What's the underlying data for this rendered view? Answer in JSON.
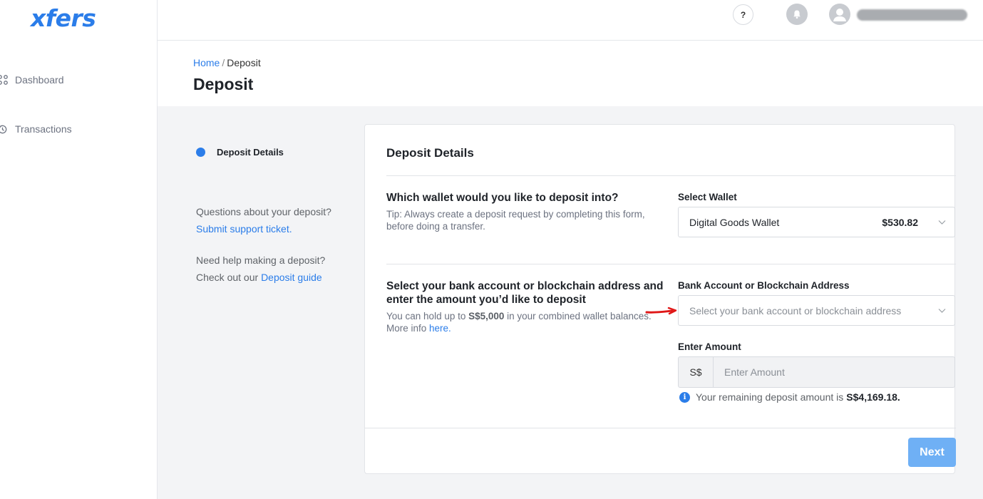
{
  "brand": {
    "logo": "xfers",
    "accent": "#2b7de9"
  },
  "sidebar": {
    "items": [
      {
        "label": "Dashboard",
        "icon": "grid-icon"
      },
      {
        "label": "Transactions",
        "icon": "history-icon"
      }
    ]
  },
  "header": {
    "help_label": "?"
  },
  "breadcrumb": {
    "home": "Home",
    "separator": "/",
    "current": "Deposit"
  },
  "page": {
    "title": "Deposit"
  },
  "steps": {
    "current": "Deposit Details"
  },
  "help": {
    "line1": "Questions about your deposit?",
    "link1": "Submit support ticket.",
    "line2": "Need help making a deposit?",
    "line3_prefix": "Check out our ",
    "link2": "Deposit guide"
  },
  "card": {
    "title": "Deposit Details",
    "wallet_question": "Which wallet would you like to deposit into?",
    "wallet_tip": "Tip: Always create a deposit request by completing this form, before doing a transfer.",
    "wallet_label": "Select Wallet",
    "wallet_selected": "Digital Goods Wallet",
    "wallet_balance": "$530.82",
    "bank_question": "Select your bank account or blockchain address and enter the amount you’d like to deposit",
    "bank_sub_prefix": "You can hold up to ",
    "bank_sub_limit": "S$5,000",
    "bank_sub_mid": " in your combined wallet balances. More info ",
    "bank_sub_link": "here.",
    "bank_label": "Bank Account or Blockchain Address",
    "bank_placeholder": "Select your bank account or blockchain address",
    "amount_label": "Enter Amount",
    "amount_prefix": "S$",
    "amount_placeholder": "Enter Amount",
    "remaining_text": "Your remaining deposit amount is",
    "remaining_value": "S$4,169.18.",
    "next_label": "Next"
  }
}
